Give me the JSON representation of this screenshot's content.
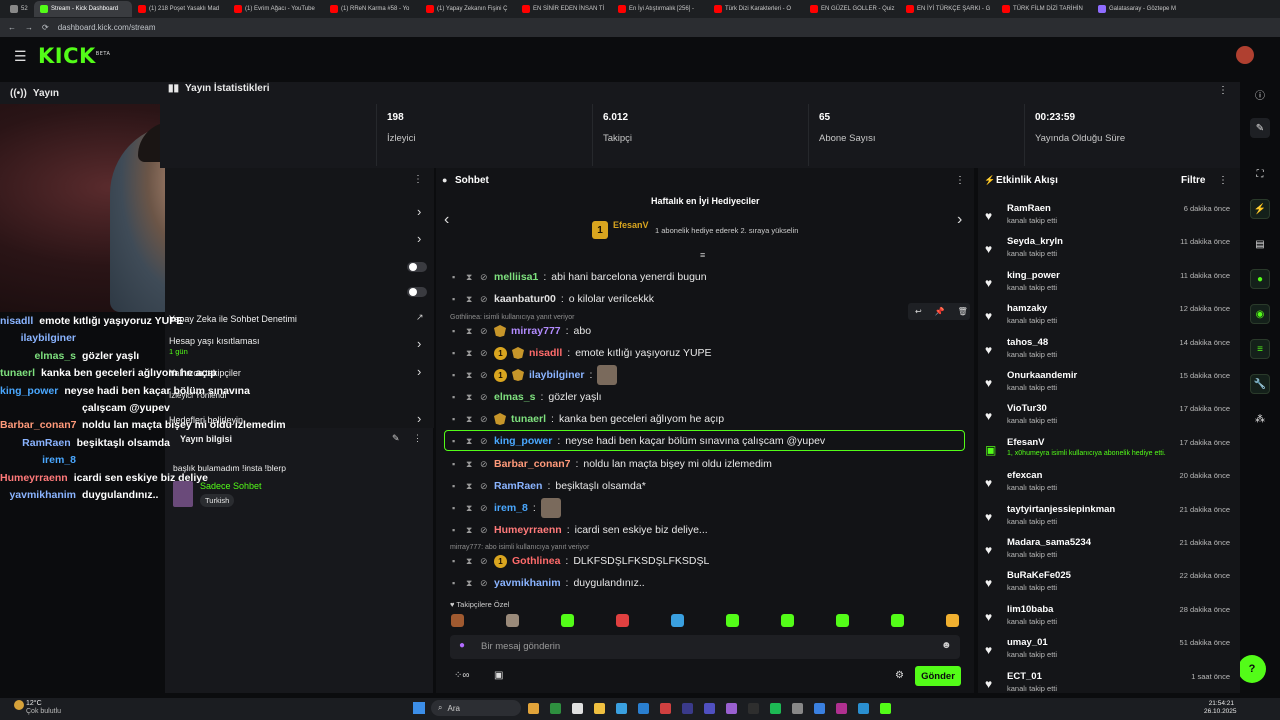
{
  "browser": {
    "tabs": [
      {
        "label": "52",
        "color": "#888"
      },
      {
        "label": "Stream - Kick Dashboard",
        "color": "#53fc18",
        "active": true
      },
      {
        "label": "(1) 218 Poşet Yasaklı Mad",
        "color": "#ff0000"
      },
      {
        "label": "(1) Evrim Ağacı - YouTube",
        "color": "#ff0000"
      },
      {
        "label": "(1) RReN Karma #58 - Yo",
        "color": "#ff0000"
      },
      {
        "label": "(1) Yapay Zekanın Fişini Ç",
        "color": "#ff0000"
      },
      {
        "label": "EN SİNİR EDEN İNSAN Tİ",
        "color": "#ff0000"
      },
      {
        "label": "En İyi Atıştırmalık [256] -",
        "color": "#ff0000"
      },
      {
        "label": "Türk Dizi Karakterleri - O",
        "color": "#ff0000"
      },
      {
        "label": "EN GÜZEL GOLLER - Quiz",
        "color": "#ff0000"
      },
      {
        "label": "EN İYİ TÜRKÇE ŞARKI - G",
        "color": "#ff0000"
      },
      {
        "label": "TÜRK FİLM DİZİ TARİHİN",
        "color": "#ff0000"
      },
      {
        "label": "Galatasaray - Göztepe M",
        "color": "#8f6cff"
      }
    ],
    "url": "dashboard.kick.com/stream"
  },
  "brand": {
    "logo": "KICK",
    "beta": "BETA",
    "accent": "#53fc18"
  },
  "left": {
    "header": "Yayın",
    "overlay_chat": [
      {
        "user": "nisadll",
        "msg": "emote kıtlığı yaşıyoruz YUPE",
        "color": "#8ab4ff"
      },
      {
        "user": "ilaybilginer",
        "msg": "",
        "color": "#8ab4ff"
      },
      {
        "user": "elmas_s",
        "msg": "gözler yaşlı",
        "color": "#7ee07e"
      },
      {
        "user": "tunaerl",
        "msg": "kanka ben geceleri ağlıyom he açıp",
        "color": "#7ee07e"
      },
      {
        "user": "king_power",
        "msg": "neyse hadi ben kaçar bölüm sınavına",
        "color": "#4aa8ff"
      },
      {
        "user": "",
        "msg": "çalışcam @yupev",
        "color": "#4aa8ff"
      },
      {
        "user": "Barbar_conan7",
        "msg": "noldu lan maçta bişey mi oldu izlemedim",
        "color": "#ff9a7a"
      },
      {
        "user": "RamRaen",
        "msg": "beşiktaşlı olsamda",
        "color": "#8ab4ff"
      },
      {
        "user": "irem_8",
        "msg": "",
        "color": "#4aa8ff"
      },
      {
        "user": "Humeyrraenn",
        "msg": "icardi sen eskiye biz deliye",
        "color": "#ff7a7a"
      },
      {
        "user": "yavmikhanim",
        "msg": "duygulandınız..",
        "color": "#8ab4ff"
      }
    ],
    "mid": {
      "ai_moderation": "Yapay Zeka ile Sohbet Denetimi",
      "age_restricted": "Hesap yaşı kısıtlaması",
      "age_value": "1 gün",
      "followers_only": "Yalnızca takipçiler",
      "followers_label": "İzleyici Yönlendi",
      "goals": "Hedefleri belirleyin",
      "stream_info": "Yayın bilgisi",
      "title": "başlık bulamadım !insta !blerp",
      "category": "Sadece Sohbet",
      "language": "Turkish"
    }
  },
  "stats": {
    "title": "Yayın İstatistikleri",
    "items": [
      {
        "value": "198",
        "label": "İzleyici"
      },
      {
        "value": "6.012",
        "label": "Takipçi"
      },
      {
        "value": "65",
        "label": "Abone Sayısı"
      },
      {
        "value": "00:23:59",
        "label": "Yayında Olduğu Süre"
      }
    ]
  },
  "chat": {
    "title": "Sohbet",
    "top_gifters_title": "Haftalık en İyi Hediyeciler",
    "top_gifter": "EfesanV",
    "top_gifter_count": "1",
    "gift_hint": "1 abonelik hediye ederek 2. sıraya yükselin",
    "reply1": "Gothlinea: isimli kullanıcıya yanıt veriyor",
    "reply2": "mirray777: abo isimli kullanıcıya yanıt veriyor",
    "messages": [
      {
        "user": "melliisa1",
        "text": "abi hani barcelona yenerdi bugun",
        "color": "#7ee07e",
        "badge": ""
      },
      {
        "user": "kaanbatur00",
        "text": "o kilolar verilcekkk",
        "color": "#e0e0e0",
        "badge": ""
      },
      {
        "user": "mirray777",
        "text": "abo",
        "color": "#b38cff",
        "badge": ""
      },
      {
        "user": "nisadll",
        "text": "emote kıtlığı yaşıyoruz YUPE",
        "color": "#ff6b6b",
        "badge": "1"
      },
      {
        "user": "ilaybilginer",
        "text": "",
        "color": "#8ab4ff",
        "badge": "1"
      },
      {
        "user": "elmas_s",
        "text": "gözler yaşlı",
        "color": "#7ee07e",
        "badge": ""
      },
      {
        "user": "tunaerl",
        "text": "kanka ben geceleri ağlıyom he açıp",
        "color": "#7ee07e",
        "badge": ""
      },
      {
        "user": "king_power",
        "text": "neyse hadi ben kaçar bölüm sınavına çalışcam @yupev",
        "color": "#4aa8ff",
        "badge": ""
      },
      {
        "user": "Barbar_conan7",
        "text": "noldu lan maçta bişey mi oldu izlemedim",
        "color": "#ff9a7a",
        "badge": ""
      },
      {
        "user": "RamRaen",
        "text": "beşiktaşlı olsamda*",
        "color": "#8ab4ff",
        "badge": ""
      },
      {
        "user": "irem_8",
        "text": "",
        "color": "#4aa8ff",
        "badge": ""
      },
      {
        "user": "Humeyrraenn",
        "text": "icardi sen eskiye biz deliye...",
        "color": "#ff7a7a",
        "badge": ""
      },
      {
        "user": "Gothlinea",
        "text": "DLKFSDŞLFKSDŞLFKSDŞL",
        "color": "#ff6b6b",
        "badge": "1"
      },
      {
        "user": "yavmikhanim",
        "text": "duygulandınız..",
        "color": "#8ab4ff",
        "badge": ""
      }
    ],
    "emote_section": "Takipçilere Özel",
    "input_placeholder": "Bir mesaj gönderin",
    "send": "Gönder"
  },
  "activity": {
    "title": "Etkinlik Akışı",
    "filter": "Filtre",
    "events": [
      {
        "name": "RamRaen",
        "desc": "kanalı takip etti",
        "time": "6 dakika önce"
      },
      {
        "name": "Seyda_kryln",
        "desc": "kanalı takip etti",
        "time": "11 dakika önce"
      },
      {
        "name": "king_power",
        "desc": "kanalı takip etti",
        "time": "11 dakika önce"
      },
      {
        "name": "hamzaky",
        "desc": "kanalı takip etti",
        "time": "12 dakika önce"
      },
      {
        "name": "tahos_48",
        "desc": "kanalı takip etti",
        "time": "14 dakika önce"
      },
      {
        "name": "Onurkaandemir",
        "desc": "kanalı takip etti",
        "time": "15 dakika önce"
      },
      {
        "name": "VioTur30",
        "desc": "kanalı takip etti",
        "time": "17 dakika önce"
      },
      {
        "name": "EfesanV",
        "desc": "1, x0humeyra isimli kullanıcıya abonelik hediye etti.",
        "time": "17 dakika önce",
        "gift": true
      },
      {
        "name": "efexcan",
        "desc": "kanalı takip etti",
        "time": "20 dakika önce"
      },
      {
        "name": "taytyirtanjessiepinkman",
        "desc": "kanalı takip etti",
        "time": "21 dakika önce"
      },
      {
        "name": "Madara_sama5234",
        "desc": "kanalı takip etti",
        "time": "21 dakika önce"
      },
      {
        "name": "BuRaKeFe025",
        "desc": "kanalı takip etti",
        "time": "22 dakika önce"
      },
      {
        "name": "lim10baba",
        "desc": "kanalı takip etti",
        "time": "28 dakika önce"
      },
      {
        "name": "umay_01",
        "desc": "kanalı takip etti",
        "time": "51 dakika önce"
      },
      {
        "name": "ECT_01",
        "desc": "kanalı takip etti",
        "time": "1 saat önce"
      }
    ]
  },
  "taskbar": {
    "weather": "12°C",
    "weather_desc": "Çok bulutlu",
    "search": "Ara",
    "time": "21:54:21",
    "date": "26.10.2025"
  }
}
